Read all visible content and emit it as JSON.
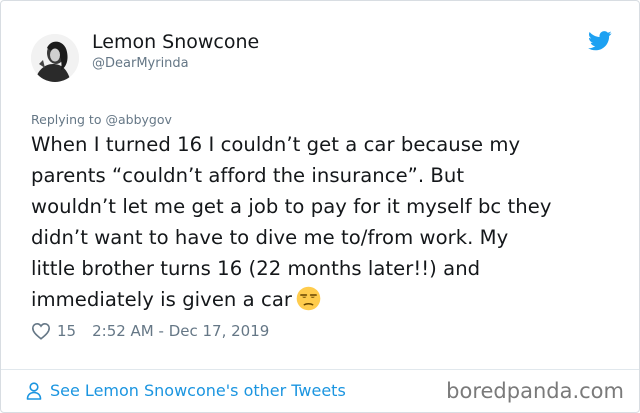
{
  "tweet": {
    "author": {
      "display_name": "Lemon Snowcone",
      "handle": "@DearMyrinda"
    },
    "reply_context": {
      "prefix": "Replying to",
      "mention": "@abbygov"
    },
    "text_lines": [
      "When I turned 16 I couldn’t get a car because my",
      "parents “couldn’t afford the insurance”. But",
      "wouldn’t let me get a job to pay for it myself bc they",
      "didn’t want to have to dive me to/from work. My",
      "little brother turns 16 (22 months later!!) and",
      "immediately is given a car"
    ],
    "emoji": "unamused-face",
    "like_count": "15",
    "timestamp": "2:52 AM - Dec 17, 2019",
    "footer_link": "See Lemon Snowcone's other Tweets",
    "icons": {
      "brand": "twitter-bird-icon",
      "like": "heart-icon",
      "profile": "person-icon"
    },
    "colors": {
      "brand_blue": "#1da1f2",
      "link_blue": "#1b95e0",
      "secondary_text": "#657786",
      "primary_text": "#14171a"
    }
  },
  "watermark": "boredpanda.com"
}
